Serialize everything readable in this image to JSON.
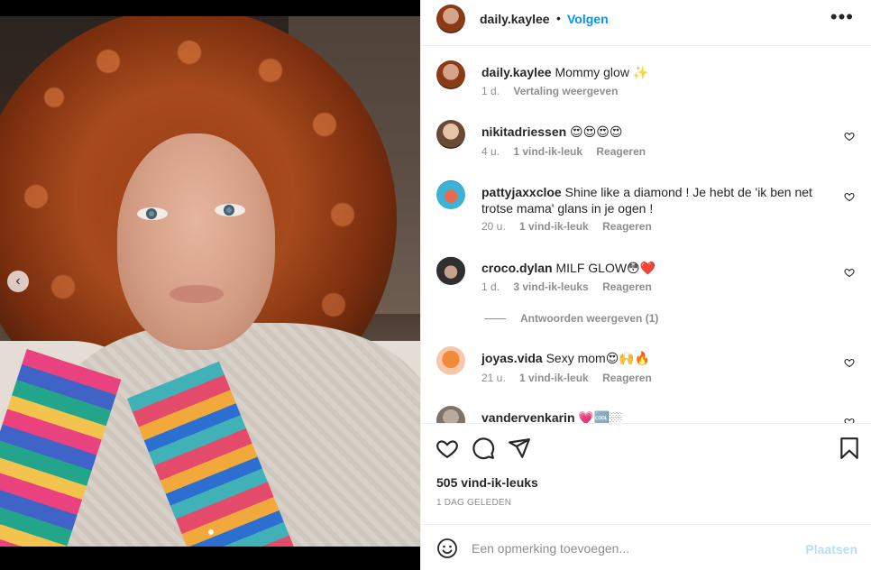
{
  "post": {
    "username": "daily.kaylee",
    "separator": "•",
    "follow_label": "Volgen",
    "more_label": "•••",
    "caption": {
      "username": "daily.kaylee",
      "text": "Mommy glow ✨",
      "time": "1 d.",
      "translate_label": "Vertaling weergeven"
    }
  },
  "comments": [
    {
      "username": "nikitadriessen",
      "text": "😍😍😍😍",
      "time": "4 u.",
      "likes": "1 vind-ik-leuk",
      "reply": "Reageren"
    },
    {
      "username": "pattyjaxxcloe",
      "text": "Shine like a diamond ! Je hebt de 'ik ben net trotse mama' glans in je ogen !",
      "time": "20 u.",
      "likes": "1 vind-ik-leuk",
      "reply": "Reageren"
    },
    {
      "username": "croco.dylan",
      "text": "MILF GLOW😳❤️",
      "time": "1 d.",
      "likes": "3 vind-ik-leuks",
      "reply": "Reageren",
      "view_replies": "Antwoorden weergeven (1)"
    },
    {
      "username": "joyas.vida",
      "text": "Sexy mom😍🙌🔥",
      "time": "21 u.",
      "likes": "1 vind-ik-leuk",
      "reply": "Reageren"
    },
    {
      "username": "vandervenkarin",
      "text": "💗🆒🏼"
    }
  ],
  "footer": {
    "likes_count": "505 vind-ik-leuks",
    "date": "1 DAG GELEDEN",
    "comment_placeholder": "Een opmerking toevoegen...",
    "post_label": "Plaatsen"
  },
  "icons": {
    "like": "heart-icon",
    "comment": "comment-icon",
    "share": "paper-plane-icon",
    "save": "bookmark-icon",
    "emoji": "emoji-icon",
    "carousel_prev": "chevron-left-icon"
  },
  "colors": {
    "accent": "#0095f6",
    "post_disabled": "#b2dffc",
    "muted": "#8e8e8e"
  }
}
